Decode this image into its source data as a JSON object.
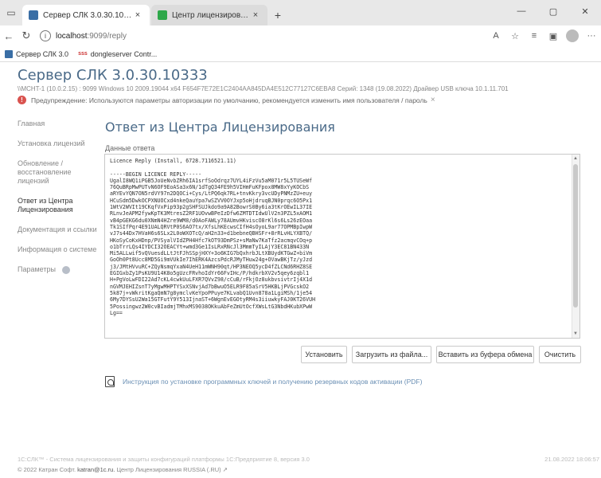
{
  "browser": {
    "tabs": [
      {
        "title": "Сервер СЛК 3.0.30.10333",
        "close": "×",
        "favicon_color": "#3a6ea5"
      },
      {
        "title": "Центр лицензирования СЛК",
        "close": "×",
        "favicon_color": "#2ea84a"
      }
    ],
    "new_tab": "+",
    "window": {
      "minimize": "—",
      "maximize": "▢",
      "close": "✕"
    },
    "url_host": "localhost",
    "url_rest": ":9099/reply",
    "bookmarks": [
      "Сервер СЛК 3.0",
      "dongleserver Contr..."
    ],
    "bookmark_prefix": "sss"
  },
  "page": {
    "title": "Сервер СЛК 3.0.30.10333",
    "server_info": "\\\\MCHT-1 (10.0.2.15) : 9099   Windows 10 2009.19044 x64   F654F7E72E1C2404AA845DA4E512C77127C6EBA8   Серий: 1348 (19.08.2022)   Драйвер USB ключа 10.1.11.701",
    "warning": "Предупреждение: Используются параметры авторизации по умолчанию, рекомендуется изменить имя пользователя / пароль",
    "warning_close": "×"
  },
  "sidebar": {
    "items": [
      {
        "label": "Главная"
      },
      {
        "label": "Установка лицензий"
      },
      {
        "label": "Обновление / восстановление лицензий"
      },
      {
        "label": "Ответ из Центра Лицензирования"
      },
      {
        "label": "Документация и ссылки"
      },
      {
        "label": "Информация о системе"
      },
      {
        "label": "Параметры"
      }
    ]
  },
  "main": {
    "heading": "Ответ из Центра Лицензирования",
    "field_label": "Данные ответа",
    "reply_text": "Licence Reply (Install, 6728.7116521.11)\n\n-----BEGIN LICENCE REPLY-----\nUgalI8WQ1iPGB5JoUeNvbZRh6IA1srfSoOdrqz7UYL4iFzVu5aM071r5L5TUSeWf\n76QuBRpMwPUTvN6OF9EoASa3x6N/1dTgQ34FE9h5VIHmFuKFpox8MW8xYyKOCbS\naRYEvYQN7ON5rdVY97n2DQOCi+Cys/LtPQ6qk7RL+tnvKkry3vcUDyPNMzZU+euy\nHCuSdm5DwkOCPXNUOCxd4nkeQauYpa7wSZVV0OYJxp5oHjdruqBJN0prqc6O5Px1\n1WtV2WVIt19CKqfVxPip93p2gSHFSUJkdo9a9A82BowrS0By6ia3tKrOEwIL37IE\nRLnvJeAPM2fywKpTK3MtresZ2RF1UOvwBPeIzDfw6ZMTDTIdwUlV2n3PZL5xAOM1\nvB4pGEKG6du0XNmN4HZre9WM8/d0AoFAWLy78AUmvHKviscO8rKl6s6Ls26zEOaa\nTk1SIfPqr4E91UALQRVtP0S6AO7tx/XfsLhKEcwsCIfH4sOyoL9ar77OPMBpIwpW\nvJ7s44Dx7HVaH6s6SLx2L0oWXOTcQ/aH2n33+d1bebneQBHSFr+8rRLvHLYXBTQ/\nHKoSyCoKxHDnp/PVSyalVIdZPH4Hfc7kOT93DmPSz+sMaNw7KaTfz2acmqvCOq+p\no1bTrrLQs4IYDCI32OEACYt+wmd3Ge1IsLRxRNcJl3MmmTyILAjY3EC81BN433N\nMi5ALLwif5vQVuesdLLtJtFJhSSpjHXY+3o6KIG7bQxhrbJLtXBUydKTGwZ+biVm\nGoOh0Pt8Ucc8MD5Gi9mVUkIe7IhERK4AzcsPdcRJMyTHuw24g+OVawBKjTz/yJzd\nj3/JMtHVvuRC+ZQyNsmqYxaN4UeH11mWNH90qt/HP3NEOQ5ycD4fZLCNd6RHZ8SE\nEGIGxbZy1PsKU9U14K8o5gUzcFRvhoIdYr66FvIHc/P/hdkrbXV2v5qey6zqbl1\nH+PgVoLwFDI22Ad7cKL4cwkUuLFXR7QVvZ98/cCuB/rFkjOz8ukbvsivtrIj4X1d\nnGVMJEHIZsnT7yMgwMHPTYSxXSNvjAd7bBwuO5ELR9F85aSrV5HKBLjPVGcskO2\n5k87j+vWkritKgaQmN7g8ymclvKeYpoPPuye7KLvabQ1Uvn878a1LgiMSh/1je54\n6My7DYSsU2Wa15GTFutY9Y513IjnaST+6WgnEvEGOtyRM4s3iiuwkyFAJ0KT26VUH\n5Possingwz2W0cvBIadmjTMhxMS9038OKkuAbFeZmUtOcfXWsLtG3NbdHKubXPwW\nLg==",
    "buttons": [
      "Установить",
      "Загрузить из файла...",
      "Вставить из буфера обмена",
      "Очистить"
    ],
    "pdf_link": "Инструкция по установке программных ключей и получению резервных кодов активации (PDF)"
  },
  "footer": {
    "left": "1С:СЛК™ - Система лицензирования и защиты конфигураций платформы 1С:Предприятие 8, версия 3.0",
    "right": "21.08.2022 18:06:57",
    "copyright": "© 2022 Катран Софт.",
    "email": "katran@1c.ru.",
    "center": "Центр Лицензирования RUSSIA (.RU)",
    "ext_link": "↗"
  },
  "colors": {
    "accent": "#4a6a88",
    "link": "#6a8fb4",
    "warning": "#d9534f"
  }
}
